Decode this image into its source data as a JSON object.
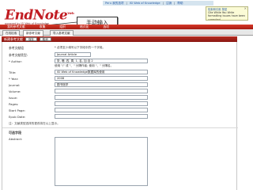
{
  "topbar": {
    "items": [
      "Peru 我的选项",
      "ISI Web of Knowledge",
      "注销",
      "帮助"
    ],
    "separator": "|"
  },
  "logo": {
    "name": "EndNote",
    "superscript": "Web",
    "subtitle": "powered by ISI Web of Knowledge"
  },
  "notice": {
    "title": "检索和引用 按钮",
    "text": "Cite While You Write formatting issues have been corrected",
    "close": "×"
  },
  "callout": {
    "text": "手动输入"
  },
  "nav": {
    "items": [
      "我的参考文献",
      "收集",
      "组织",
      "格式化",
      "选项"
    ]
  },
  "tabs": {
    "items": [
      "在线检索",
      "新参考文献",
      "导入参考文献"
    ],
    "active_index": 1
  },
  "panel": {
    "title": "新建参考文献",
    "save_label": "保存",
    "cancel_label": "取消"
  },
  "form": {
    "group_label": "参考文献组",
    "group_hint": "* 必须至少填写以下字段中的一个字段。",
    "ref_type_label": "参考文献类型:",
    "ref_type_value": "Journal Article",
    "author_label": "* Author:",
    "author_lines": [
      "张, 珊, 四, 周, 1, 名, 加 自 2",
      "使用 \"/\" 或 \"、\" 分隔作者; 使用 \"、\" 分隔名。"
    ],
    "title_label": "Title:",
    "title_value": "ISI Web of Knowledge数据库的使用",
    "year_label": "* Year:",
    "year_value": "2008",
    "journal_label": "Journal:",
    "journal_value": "图书馆学",
    "volume_label": "Volume:",
    "issue_label": "Issue:",
    "pages_label": "Pages:",
    "start_page_label": "Start Page:",
    "epub_label": "Epub Date:",
    "more_hint": "注：文献类型选择的更改将在以上显示。",
    "abstract_section": "可选字段",
    "abstract_label": "Abstract:"
  }
}
